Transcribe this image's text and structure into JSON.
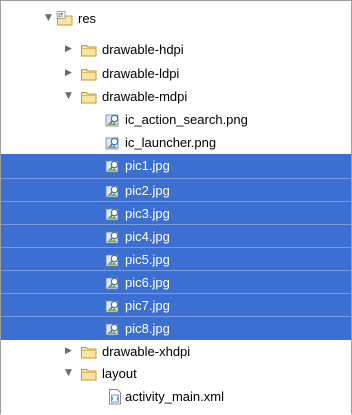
{
  "tree": {
    "root": {
      "label": "res",
      "expanded": true
    },
    "items": [
      {
        "label": "drawable-hdpi",
        "kind": "folder",
        "expanded": false
      },
      {
        "label": "drawable-ldpi",
        "kind": "folder",
        "expanded": false
      },
      {
        "label": "drawable-mdpi",
        "kind": "folder",
        "expanded": true
      },
      {
        "label": "ic_action_search.png",
        "kind": "image",
        "selected": false
      },
      {
        "label": "ic_launcher.png",
        "kind": "image",
        "selected": false
      },
      {
        "label": "pic1.jpg",
        "kind": "image",
        "selected": true
      },
      {
        "label": "pic2.jpg",
        "kind": "image",
        "selected": true
      },
      {
        "label": "pic3.jpg",
        "kind": "image",
        "selected": true
      },
      {
        "label": "pic4.jpg",
        "kind": "image",
        "selected": true
      },
      {
        "label": "pic5.jpg",
        "kind": "image",
        "selected": true
      },
      {
        "label": "pic6.jpg",
        "kind": "image",
        "selected": true
      },
      {
        "label": "pic7.jpg",
        "kind": "image",
        "selected": true
      },
      {
        "label": "pic8.jpg",
        "kind": "image",
        "selected": true
      },
      {
        "label": "drawable-xhdpi",
        "kind": "folder",
        "expanded": false
      },
      {
        "label": "layout",
        "kind": "folder",
        "expanded": true
      },
      {
        "label": "activity_main.xml",
        "kind": "xml-file",
        "selected": false
      }
    ]
  },
  "icons": {
    "expanded_twisty": "triangle-down-icon",
    "collapsed_twisty": "triangle-right-icon",
    "folder": "folder-icon",
    "resource_folder": "resource-folder-icon",
    "image_file": "image-file-icon",
    "xml_file": "xml-file-icon"
  },
  "colors": {
    "selection": "#3b6fd2",
    "selection_text": "#ffffff",
    "folder_fill": "#fbe4a3",
    "folder_stroke": "#c99a2e",
    "twisty": "#6b6b6b"
  }
}
